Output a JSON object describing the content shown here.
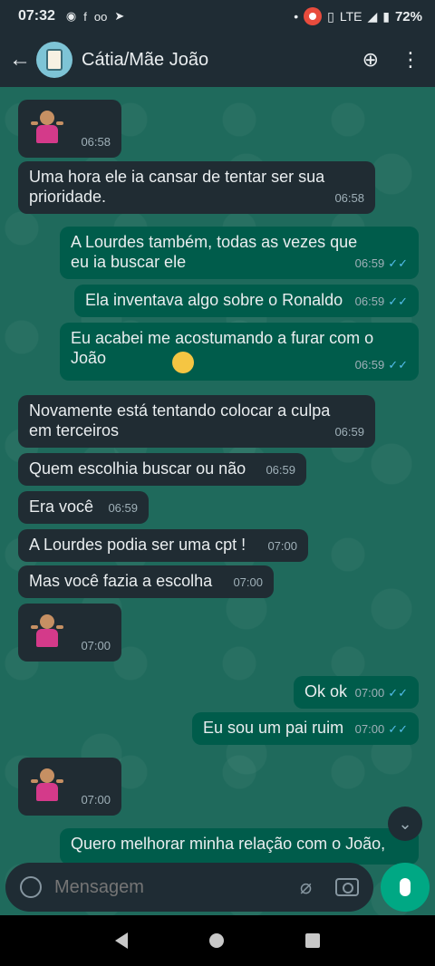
{
  "status": {
    "time": "07:32",
    "network": "LTE",
    "battery": "72%"
  },
  "header": {
    "back_label": "←",
    "title": "Cátia/Mãe João",
    "add_call_label": "⊕",
    "menu_label": "⋮"
  },
  "messages": [
    {
      "text": "",
      "time": "06:58"
    },
    {
      "text": "Uma hora ele ia cansar de tentar ser sua prioridade.",
      "time": "06:58"
    },
    {
      "text": "A Lourdes também, todas as vezes que eu ia buscar ele",
      "time": "06:59"
    },
    {
      "text": "Ela inventava algo sobre o Ronaldo",
      "time": "06:59"
    },
    {
      "text": "Eu acabei me acostumando a furar com o João",
      "time": "06:59"
    },
    {
      "text": "Novamente está tentando colocar a culpa em terceiros",
      "time": "06:59"
    },
    {
      "text": "Quem escolhia buscar ou não",
      "time": "06:59"
    },
    {
      "text": "Era você",
      "time": "06:59"
    },
    {
      "text": "A Lourdes podia ser uma cpt !",
      "time": "07:00"
    },
    {
      "text": "Mas você fazia a escolha",
      "time": "07:00"
    },
    {
      "text": "",
      "time": "07:00"
    },
    {
      "text": "Ok ok",
      "time": "07:00"
    },
    {
      "text": "Eu sou um pai ruim",
      "time": "07:00"
    },
    {
      "text": "",
      "time": "07:00"
    },
    {
      "text": "Quero melhorar minha relação com o João,",
      "time": ""
    }
  ],
  "input": {
    "placeholder": "Mensagem"
  },
  "ticks": "✓✓"
}
